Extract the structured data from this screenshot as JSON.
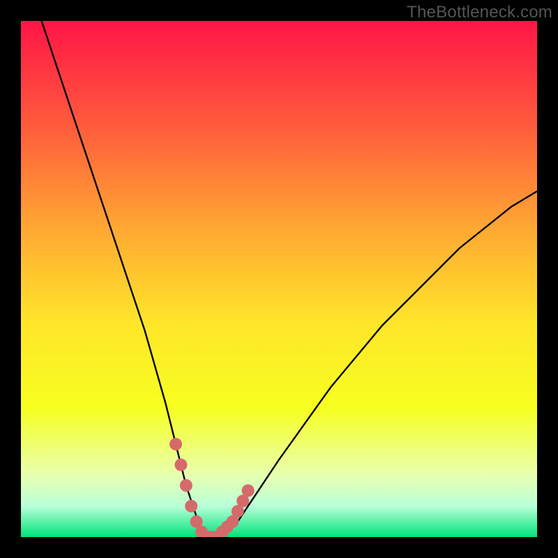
{
  "watermark": "TheBottleneck.com",
  "chart_data": {
    "type": "line",
    "title": "",
    "xlabel": "",
    "ylabel": "",
    "xlim": [
      0,
      100
    ],
    "ylim": [
      0,
      100
    ],
    "series": [
      {
        "name": "bottleneck-curve",
        "x": [
          4,
          8,
          12,
          16,
          20,
          24,
          28,
          30,
          32,
          34,
          35,
          36,
          37,
          38,
          40,
          42,
          44,
          46,
          50,
          55,
          60,
          65,
          70,
          75,
          80,
          85,
          90,
          95,
          100
        ],
        "y": [
          100,
          88,
          76,
          64,
          52,
          40,
          26,
          18,
          10,
          4,
          1,
          0,
          0,
          0,
          1,
          3,
          6,
          9,
          15,
          22,
          29,
          35,
          41,
          46,
          51,
          56,
          60,
          64,
          67
        ]
      },
      {
        "name": "highlight-points",
        "x": [
          30,
          31,
          32,
          33,
          34,
          35,
          36,
          37,
          38,
          39,
          40,
          41,
          42,
          43,
          44
        ],
        "y": [
          18,
          14,
          10,
          6,
          3,
          1,
          0,
          0,
          0,
          1,
          2,
          3,
          5,
          7,
          9
        ]
      }
    ],
    "gradient_bands": [
      {
        "stop": 0.0,
        "color": "#ff1547"
      },
      {
        "stop": 0.2,
        "color": "#ff5a3c"
      },
      {
        "stop": 0.4,
        "color": "#ffa733"
      },
      {
        "stop": 0.58,
        "color": "#ffe42a"
      },
      {
        "stop": 0.75,
        "color": "#f7ff20"
      },
      {
        "stop": 0.88,
        "color": "#e8ffb0"
      },
      {
        "stop": 0.94,
        "color": "#b8ffd8"
      },
      {
        "stop": 1.0,
        "color": "#00e37a"
      }
    ],
    "highlight_color": "#d56a6a",
    "curve_color": "#000000"
  }
}
